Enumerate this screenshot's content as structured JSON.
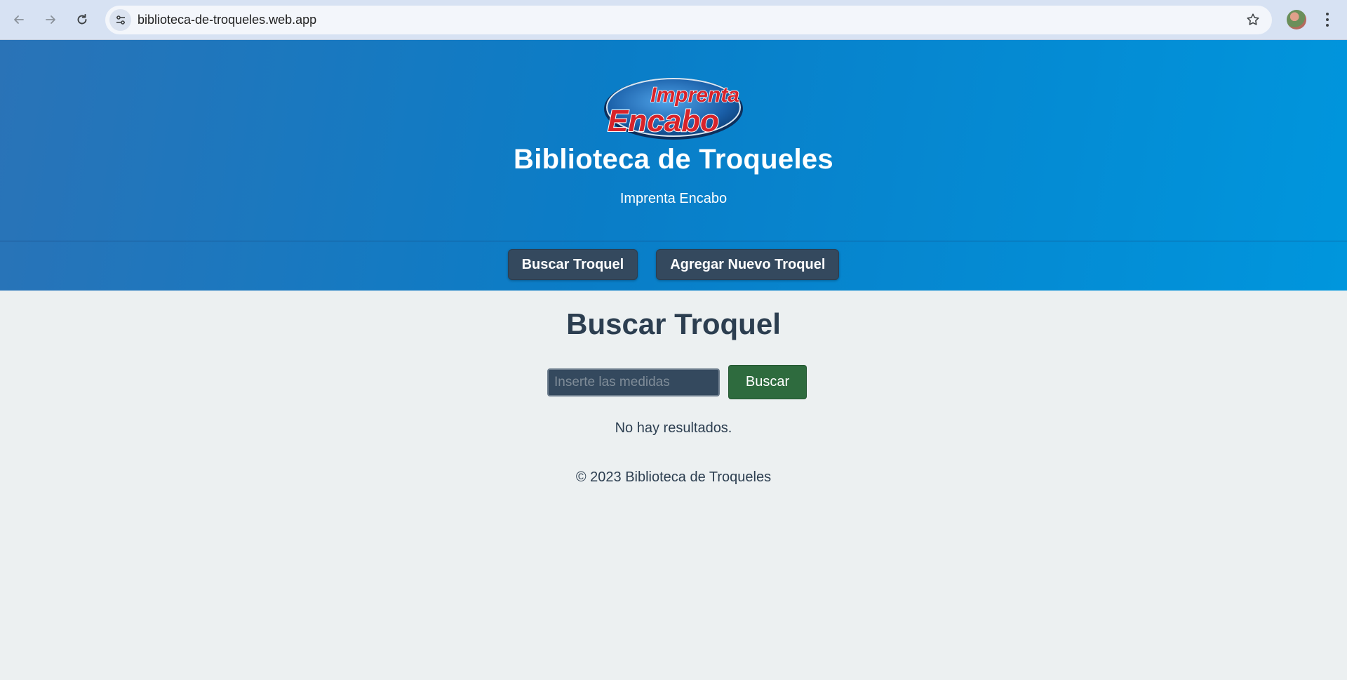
{
  "browser": {
    "url": "biblioteca-de-troqueles.web.app",
    "icons": {
      "back": "arrow-left",
      "forward": "arrow-right",
      "reload": "reload",
      "site_info": "tune",
      "bookmark": "star-outline",
      "menu": "three-dots-vertical"
    }
  },
  "header": {
    "logo_text_top": "Imprenta",
    "logo_text_bottom": "Encabo",
    "title": "Biblioteca de Troqueles",
    "subtitle": "Imprenta Encabo",
    "nav": [
      {
        "label": "Buscar Troquel"
      },
      {
        "label": "Agregar Nuevo Troquel"
      }
    ]
  },
  "main": {
    "heading": "Buscar Troquel",
    "search": {
      "placeholder": "Inserte las medidas",
      "value": "",
      "button_label": "Buscar"
    },
    "results_message": "No hay resultados."
  },
  "footer": {
    "text": "© 2023 Biblioteca de Troqueles"
  },
  "colors": {
    "header_gradient_start": "#2a73b7",
    "header_gradient_end": "#0096dd",
    "nav_button": "#34495e",
    "search_button": "#2e6b3e",
    "page_background": "#ecf0f1",
    "text_dark": "#2c3e50"
  }
}
